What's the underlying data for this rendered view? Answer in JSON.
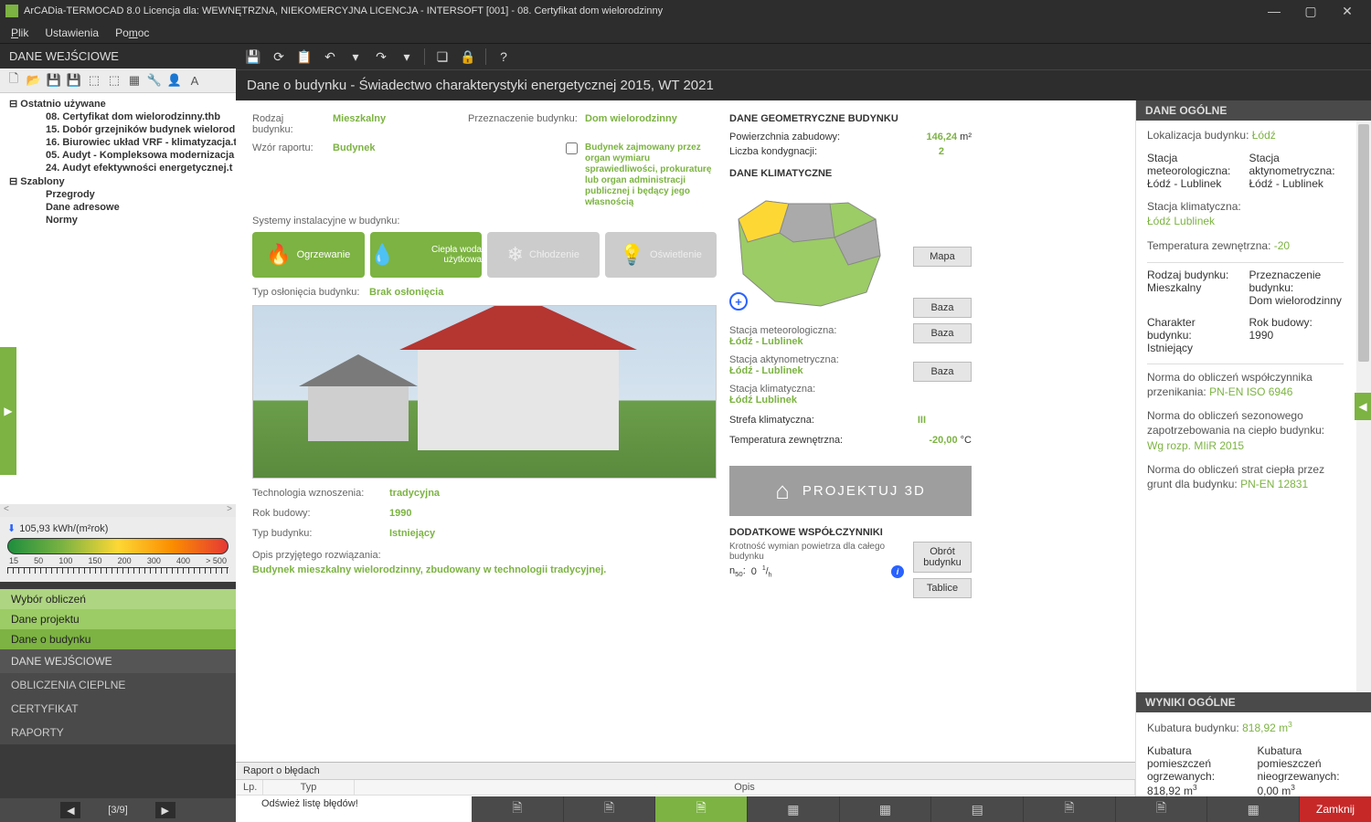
{
  "titlebar": {
    "title": "ArCADia-TERMOCAD 8.0 Licencja dla: WEWNĘTRZNA, NIEKOMERCYJNA LICENCJA - INTERSOFT [001] - 08. Certyfikat dom wielorodzinny"
  },
  "menubar": {
    "file": "Plik",
    "settings": "Ustawienia",
    "help": "Pomoc"
  },
  "left": {
    "header": "DANE WEJŚCIOWE",
    "tree": {
      "recent": "Ostatnio używane",
      "items": [
        "08. Certyfikat dom wielorodzinny.thb",
        "15. Dobór grzejników budynek wielorod",
        "16. Biurowiec układ VRF - klimatyzacja.t",
        "05. Audyt - Kompleksowa modernizacja",
        "24. Audyt efektywności energetycznej.t"
      ],
      "templates": "Szablony",
      "tpl_items": [
        "Przegrody",
        "Dane adresowe",
        "Normy"
      ]
    },
    "gauge": {
      "value": "105,93 kWh/(m²rok)",
      "ticks": [
        "15",
        "50",
        "100",
        "150",
        "200",
        "300",
        "400",
        "> 500"
      ]
    },
    "nav": {
      "a": "Wybór obliczeń",
      "b": "Dane projektu",
      "c": "Dane o budynku",
      "g1": "DANE WEJŚCIOWE",
      "g2": "OBLICZENIA CIEPLNE",
      "g3": "CERTYFIKAT",
      "g4": "RAPORTY"
    },
    "pager": "[3/9]"
  },
  "breadcrumb": "Dane o budynku - Świadectwo charakterystyki energetycznej 2015, WT 2021",
  "form": {
    "rodzaj_l": "Rodzaj budynku:",
    "rodzaj_v": "Mieszkalny",
    "przezn_l": "Przeznaczenie budynku:",
    "przezn_v": "Dom wielorodzinny",
    "wzor_l": "Wzór raportu:",
    "wzor_v": "Budynek",
    "przezn_long": "Budynek zajmowany przez organ wymiaru sprawiedliwości, prokuraturę lub organ administracji publicznej i będący jego własnością",
    "systemy_l": "Systemy instalacyjne w budynku:",
    "sys": {
      "ogrzewanie": "Ogrzewanie",
      "cwu": "Ciepła woda użytkowa",
      "chlodzenie": "Chłodzenie",
      "osw": "Oświetlenie"
    },
    "osloniecie_l": "Typ osłonięcia budynku:",
    "osloniecie_v": "Brak osłonięcia",
    "tech_l": "Technologia wznoszenia:",
    "tech_v": "tradycyjna",
    "rok_l": "Rok budowy:",
    "rok_v": "1990",
    "typ_l": "Typ budynku:",
    "typ_v": "Istniejący",
    "opis_l": "Opis przyjętego rozwiązania:",
    "opis_v": "Budynek mieszkalny wielorodzinny, zbudowany w technologii tradycyjnej."
  },
  "mid": {
    "geom_h": "DANE GEOMETRYCZNE BUDYNKU",
    "pow_l": "Powierzchnia zabudowy:",
    "pow_v": "146,24",
    "pow_u": "m²",
    "kond_l": "Liczba kondygnacji:",
    "kond_v": "2",
    "klim_h": "DANE KLIMATYCZNE",
    "mapa_btn": "Mapa",
    "baza_btn": "Baza",
    "st_meteo_l": "Stacja meteorologiczna:",
    "st_meteo_v": "Łódź - Lublinek",
    "st_akt_l": "Stacja aktynometryczna:",
    "st_akt_v": "Łódź - Lublinek",
    "st_klim_l": "Stacja klimatyczna:",
    "st_klim_v": "Łódź Lublinek",
    "strefa_l": "Strefa klimatyczna:",
    "strefa_v": "III",
    "temp_l": "Temperatura zewnętrzna:",
    "temp_v": "-20,00",
    "temp_u": "°C",
    "proj3d": "PROJEKTUJ 3D",
    "coef_h": "DODATKOWE WSPÓŁCZYNNIKI",
    "coef_txt": "Krotność wymian powietrza dla całego budynku",
    "obrot_btn": "Obrót budynku",
    "tablice_btn": "Tablice",
    "n50_l": "n",
    "n50_sub": "50",
    "n50_colon": ": ",
    "n50_v": "0",
    "n50_u": "1/h"
  },
  "right": {
    "h1": "DANE OGÓLNE",
    "lok_l": "Lokalizacja budynku:",
    "lok_v": "Łódź",
    "meteo_l": "Stacja meteorologiczna:",
    "meteo_v": "Łódź - Lublinek",
    "akt_l": "Stacja aktynometryczna:",
    "akt_v": "Łódź - Lublinek",
    "klim_l": "Stacja klimatyczna:",
    "klim_v": "Łódź Lublinek",
    "tzew_l": "Temperatura zewnętrzna:",
    "tzew_v": "-20",
    "rodz_l": "Rodzaj budynku:",
    "rodz_v": "Mieszkalny",
    "przez_l": "Przeznaczenie budynku:",
    "przez_v": "Dom wielorodzinny",
    "char_l": "Charakter budynku:",
    "char_v": "Istniejący",
    "rok_l": "Rok budowy:",
    "rok_v": "1990",
    "norm1_l": "Norma do obliczeń współczynnika przenikania:",
    "norm1_v": "PN-EN ISO 6946",
    "norm2_l": "Norma do obliczeń sezonowego zapotrzebowania na ciepło budynku:",
    "norm2_v": "Wg rozp. MIiR 2015",
    "norm3_l": "Norma do obliczeń strat ciepła przez grunt dla budynku:",
    "norm3_v": "PN-EN 12831",
    "h2": "WYNIKI OGÓLNE",
    "kub_l": "Kubatura budynku:",
    "kub_v": "818,92 m³",
    "kpo_l": "Kubatura pomieszczeń ogrzewanych:",
    "kpo_v": "818,92 m³",
    "kpn_l": "Kubatura pomieszczeń nieogrzewanych:",
    "kpn_v": "0,00 m³"
  },
  "errors": {
    "title": "Raport o błędach",
    "col1": "Lp.",
    "col2": "Typ",
    "col3": "Opis",
    "row": "Odśwież listę błędów!"
  },
  "bottom": {
    "close": "Zamknij"
  }
}
